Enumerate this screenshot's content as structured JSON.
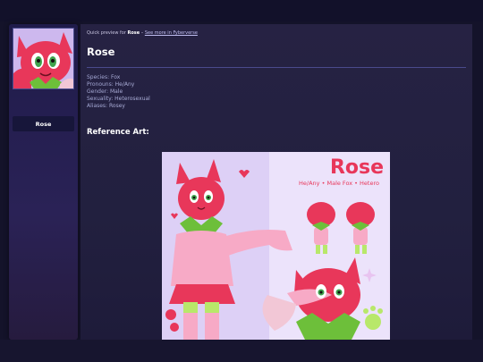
{
  "breadcrumb": {
    "prefix": "Quick preview for",
    "name": "Rose",
    "separator": "–",
    "link": "See more in Fyberverse"
  },
  "sidebar": {
    "character_name": "Rose"
  },
  "profile": {
    "title": "Rose",
    "fields": [
      {
        "label": "Species:",
        "value": "Fox"
      },
      {
        "label": "Pronouns:",
        "value": "He/Any"
      },
      {
        "label": "Gender:",
        "value": "Male"
      },
      {
        "label": "Sexuality:",
        "value": "Heterosexual"
      },
      {
        "label": "Aliases:",
        "value": "Rosey"
      }
    ]
  },
  "reference": {
    "heading": "Reference Art:",
    "art_title": "Rose",
    "art_subtitle": "He/Any • Male Fox • Hetero"
  },
  "colors": {
    "accent_pink": "#e8375a",
    "leaf_green": "#6dbf3a",
    "page_bg": "#14132a"
  }
}
